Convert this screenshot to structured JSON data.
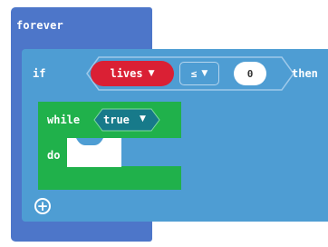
{
  "forever": {
    "label": "forever"
  },
  "if_block": {
    "label": "if",
    "then_label": "then",
    "condition": {
      "variable": "lives",
      "operator": "≤",
      "value": "0"
    }
  },
  "while_block": {
    "label": "while",
    "condition": "true",
    "do_label": "do"
  },
  "icons": {
    "dropdown": "caret-down-icon",
    "add": "plus-circle-icon"
  },
  "colors": {
    "forever": "#4d76c9",
    "if": "#4e9dd3",
    "variable": "#da2034",
    "while": "#20b14b",
    "while_condition": "#177a8a"
  }
}
